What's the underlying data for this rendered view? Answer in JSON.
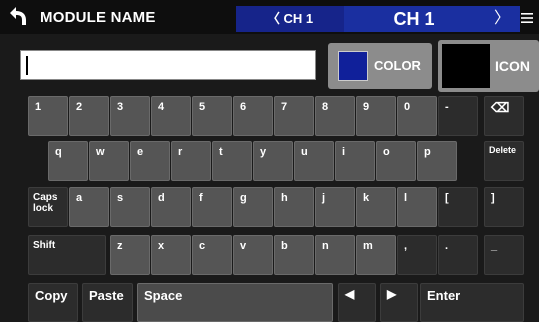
{
  "header": {
    "title": "MODULE NAME",
    "channel_prev": "〈 CH 1",
    "channel_current": "CH 1",
    "channel_next": "〉"
  },
  "input": {
    "value": ""
  },
  "buttons": {
    "color_label": "COLOR",
    "icon_label": "ICON"
  },
  "colors": {
    "accent_blue": "#1a2fa0",
    "selected_color": "#10209a"
  },
  "keyboard": {
    "row1": [
      "1",
      "2",
      "3",
      "4",
      "5",
      "6",
      "7",
      "8",
      "9",
      "0",
      "-",
      "⌫"
    ],
    "row2": [
      "q",
      "w",
      "e",
      "r",
      "t",
      "y",
      "u",
      "i",
      "o",
      "p",
      "Delete"
    ],
    "row3": [
      "Caps lock",
      "a",
      "s",
      "d",
      "f",
      "g",
      "h",
      "j",
      "k",
      "l",
      "[",
      "]"
    ],
    "row4": [
      "Shift",
      "z",
      "x",
      "c",
      "v",
      "b",
      "n",
      "m",
      ",",
      ".",
      "_"
    ],
    "row5": [
      "Copy",
      "Paste",
      "Space",
      "◀",
      "▶",
      "Enter"
    ]
  }
}
